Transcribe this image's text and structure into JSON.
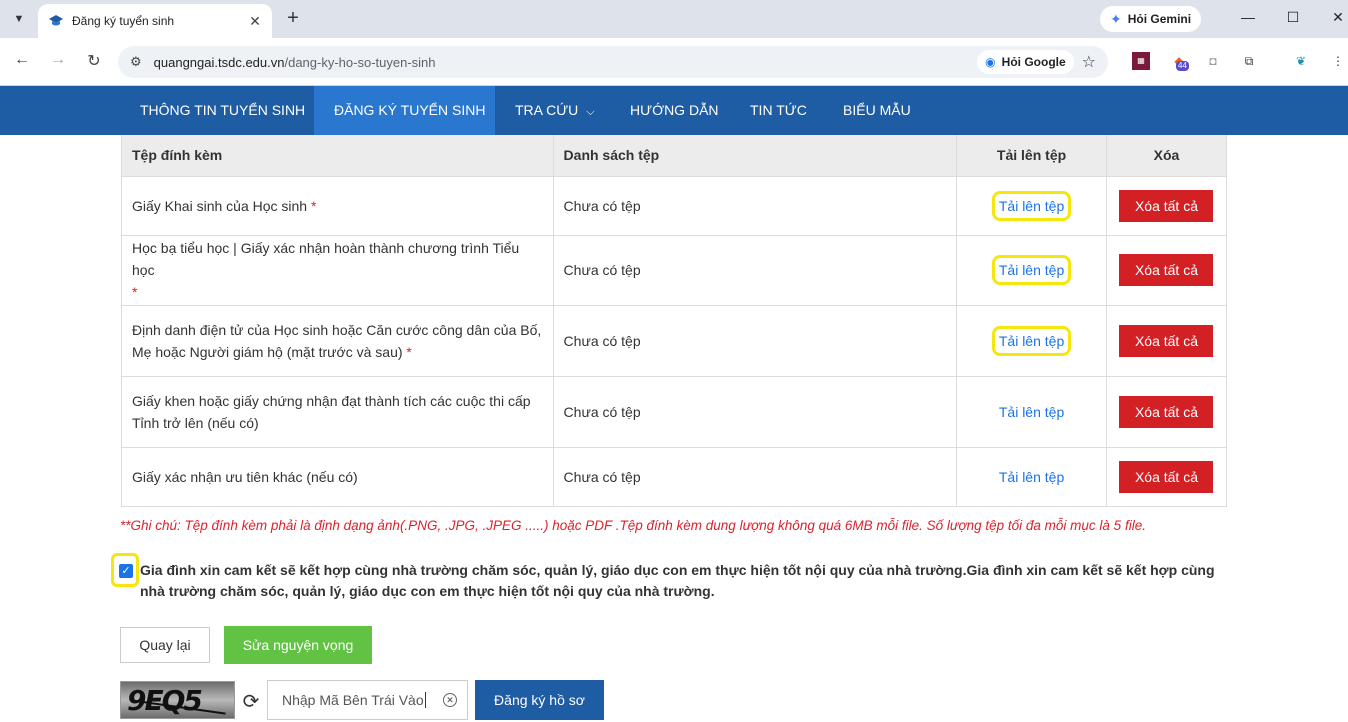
{
  "browser": {
    "tab_title": "Đăng ký tuyển sinh",
    "gemini_label": "Hỏi Gemini",
    "url_domain": "quangngai.tsdc.edu.vn",
    "url_path": "/dang-ky-ho-so-tuyen-sinh",
    "ask_google_label": "Hỏi Google",
    "ext_badge": "44"
  },
  "nav": {
    "items": [
      "THÔNG TIN TUYỂN SINH",
      "ĐĂNG KÝ TUYỂN SINH",
      "TRA CỨU",
      "HƯỚNG DẪN",
      "TIN TỨC",
      "BIỂU MẪU"
    ]
  },
  "table": {
    "headers": [
      "Tệp đính kèm",
      "Danh sách tệp",
      "Tải lên tệp",
      "Xóa"
    ],
    "rows": [
      {
        "name": "Giấy Khai sinh của Học sinh",
        "files": "Chưa có tệp",
        "upload": "Tải lên tệp",
        "delete": "Xóa tất cả"
      },
      {
        "name": "Học bạ tiểu học | Giấy xác nhận hoàn thành chương trình Tiểu học",
        "files": "Chưa có tệp",
        "upload": "Tải lên tệp",
        "delete": "Xóa tất cả"
      },
      {
        "name": "Định danh điện tử của Học sinh hoặc Căn cước công dân của Bố, Mẹ hoặc Người giám hộ (mặt trước và sau)",
        "files": "Chưa có tệp",
        "upload": "Tải lên tệp",
        "delete": "Xóa tất cả"
      },
      {
        "name": "Giấy khen hoặc giấy chứng nhận đạt thành tích các cuộc thi cấp Tỉnh trở lên (nếu có)",
        "files": "Chưa có tệp",
        "upload": "Tải lên tệp",
        "delete": "Xóa tất cả"
      },
      {
        "name": "Giấy xác nhận ưu tiên khác (nếu có)",
        "files": "Chưa có tệp",
        "upload": "Tải lên tệp",
        "delete": "Xóa tất cả"
      }
    ],
    "required_mark": "*"
  },
  "note": "**Ghi chú: Tệp đính kèm phải là định dạng ảnh(.PNG, .JPG, .JPEG .....) hoặc PDF .Tệp đính kèm dung lượng không quá 6MB mỗi file. Số lượng tệp tối đa mỗi mục là 5 file.",
  "commitment": {
    "checked": true,
    "text": "Gia đình xin cam kết sẽ kết hợp cùng nhà trường chăm sóc, quản lý, giáo dục con em thực hiện tốt nội quy của nhà trường.Gia đình xin cam kết sẽ kết hợp cùng nhà trường chăm sóc, quản lý, giáo dục con em thực hiện tốt nội quy của nhà trường."
  },
  "actions": {
    "back": "Quay lại",
    "edit": "Sửa nguyện vọng",
    "register": "Đăng ký hồ sơ"
  },
  "captcha": {
    "image_text": "9EQ5",
    "input_value": "Nhập Mã Bên Trái Vào"
  },
  "colors": {
    "navbar": "#1e5ca3",
    "nav_active": "#2a77cf",
    "delete_red": "#d32025",
    "edit_green": "#62c244",
    "highlight_yellow": "#f5e60d",
    "link_blue": "#1a73e8"
  }
}
